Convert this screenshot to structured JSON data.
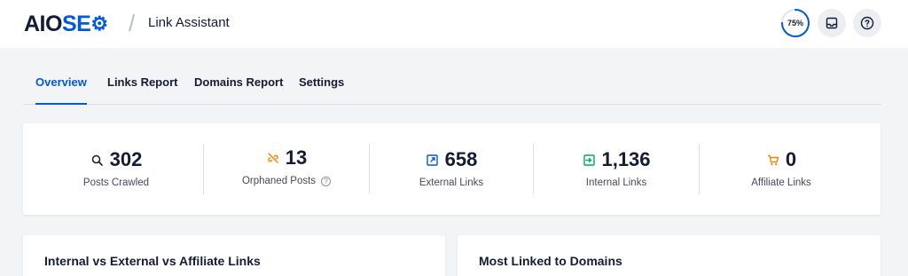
{
  "header": {
    "logo_part1": "AIO",
    "logo_part2": "SE",
    "separator": "/",
    "page_title": "Link Assistant",
    "score": "75%",
    "score_fraction": 0.75
  },
  "tabs": [
    {
      "label": "Overview",
      "active": true
    },
    {
      "label": "Links Report",
      "active": false
    },
    {
      "label": "Domains Report",
      "active": false
    },
    {
      "label": "Settings",
      "active": false
    }
  ],
  "stats": [
    {
      "value": "302",
      "label": "Posts Crawled",
      "icon": "search-icon"
    },
    {
      "value": "13",
      "label": "Orphaned Posts",
      "icon": "unlink-icon"
    },
    {
      "value": "658",
      "label": "External Links",
      "icon": "external-link-icon"
    },
    {
      "value": "1,136",
      "label": "Internal Links",
      "icon": "internal-link-icon"
    },
    {
      "value": "0",
      "label": "Affiliate Links",
      "icon": "cart-icon"
    }
  ],
  "cards": {
    "left_title": "Internal vs External vs Affiliate Links",
    "right_title": "Most Linked to Domains"
  },
  "colors": {
    "accent": "#005ae0",
    "orange": "#f18200",
    "green": "#00aa63",
    "text": "#141b38"
  }
}
